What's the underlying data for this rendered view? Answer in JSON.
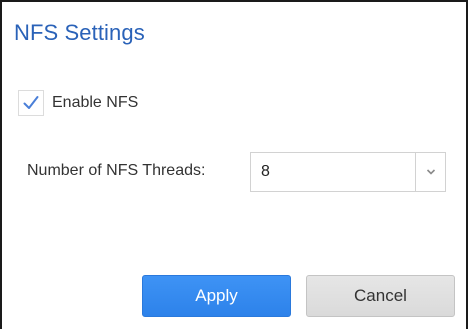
{
  "dialog": {
    "title": "NFS Settings"
  },
  "enable_nfs": {
    "label": "Enable NFS",
    "checked": true
  },
  "threads": {
    "label": "Number of NFS Threads:",
    "value": "8"
  },
  "buttons": {
    "apply": "Apply",
    "cancel": "Cancel"
  },
  "colors": {
    "title": "#2a62b8",
    "primary_button": "#3a8ef3",
    "secondary_button": "#e0e0e0",
    "checkmark": "#4a7fd8"
  },
  "icons": {
    "checkbox_mark": "checkmark-icon",
    "dropdown": "chevron-down-icon"
  }
}
